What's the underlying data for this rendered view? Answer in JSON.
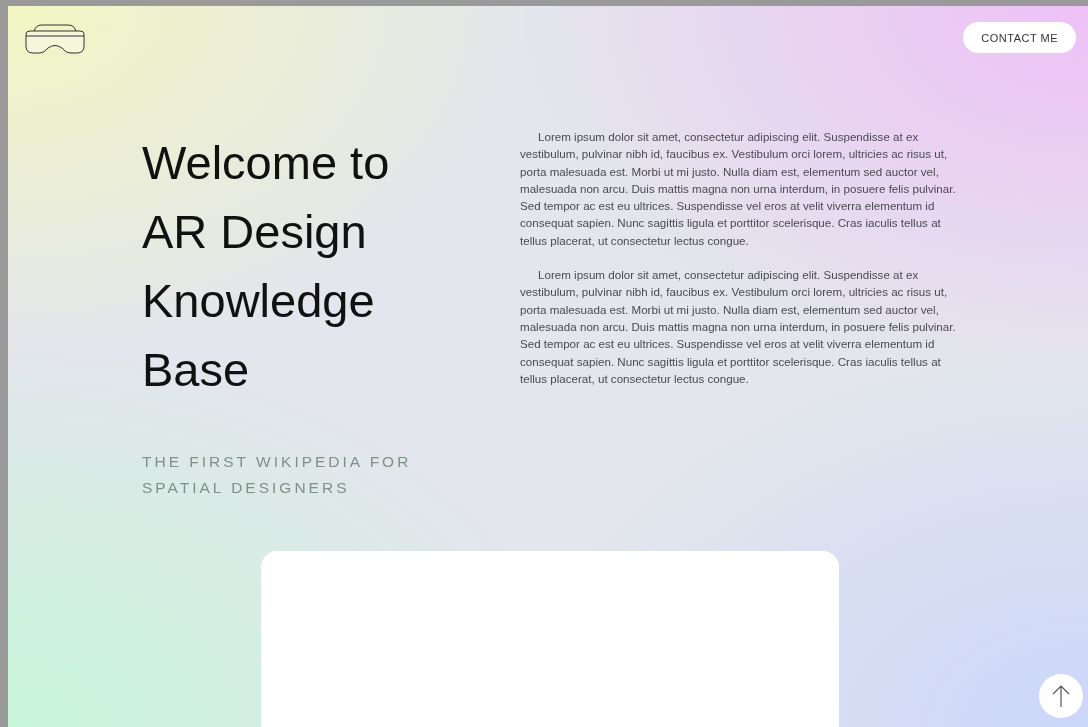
{
  "header": {
    "contact_button": "CONTACT ME"
  },
  "hero": {
    "heading_lines": [
      "Welcome to",
      "AR Design",
      "Knowledge",
      "Base"
    ],
    "subtitle_lines": [
      "THE FIRST WIKIPEDIA FOR",
      "SPATIAL DESIGNERS"
    ]
  },
  "paragraphs": [
    "Lorem ipsum dolor sit amet, consectetur adipiscing elit. Suspendisse at ex vestibulum, pulvinar nibh id, faucibus ex. Vestibulum orci lorem, ultricies ac risus ut, porta malesuada est. Morbi ut mi justo. Nulla diam est, elementum sed auctor vel, malesuada non arcu. Duis mattis magna non urna interdum, in posuere felis pulvinar. Sed tempor ac est eu ultrices. Suspendisse vel eros at velit viverra elementum id consequat sapien. Nunc sagittis ligula et porttitor scelerisque. Cras iaculis tellus at tellus placerat, ut consectetur lectus congue.",
    "Lorem ipsum dolor sit amet, consectetur adipiscing elit. Suspendisse at ex vestibulum, pulvinar nibh id, faucibus ex. Vestibulum orci lorem, ultricies ac risus ut, porta malesuada est. Morbi ut mi justo. Nulla diam est, elementum sed auctor vel, malesuada non arcu. Duis mattis magna non urna interdum, in posuere felis pulvinar. Sed tempor ac est eu ultrices. Suspendisse vel eros at velit viverra elementum id consequat sapien. Nunc sagittis ligula et porttitor scelerisque. Cras iaculis tellus at tellus placerat, ut consectetur lectus congue."
  ]
}
